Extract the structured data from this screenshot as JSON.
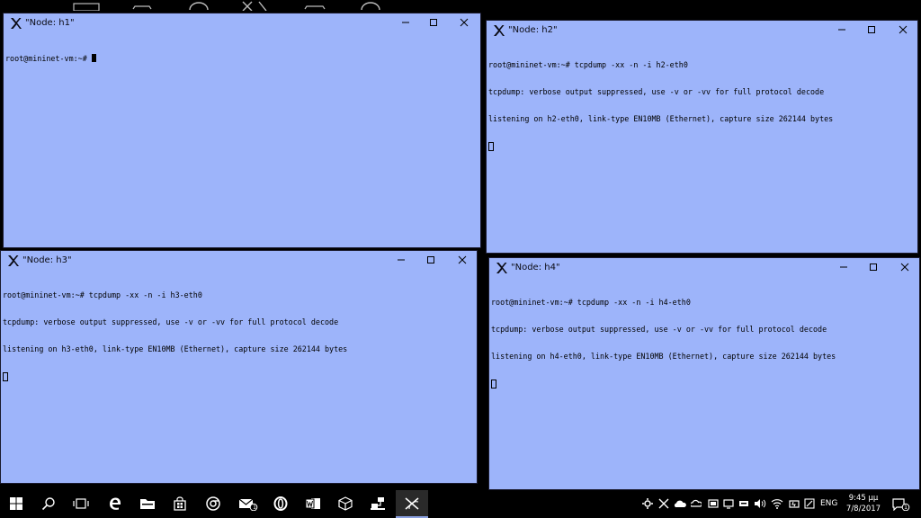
{
  "colors": {
    "window_bg": "#9db4fa",
    "desktop": "#000000",
    "taskbar": "#000000"
  },
  "windows": [
    {
      "title": "\"Node: h1\"",
      "lines": [
        "root@mininet-vm:~# "
      ]
    },
    {
      "title": "\"Node: h2\"",
      "lines": [
        "root@mininet-vm:~# tcpdump -xx -n -i h2-eth0",
        "tcpdump: verbose output suppressed, use -v or -vv for full protocol decode",
        "listening on h2-eth0, link-type EN10MB (Ethernet), capture size 262144 bytes"
      ]
    },
    {
      "title": "\"Node: h3\"",
      "lines": [
        "root@mininet-vm:~# tcpdump -xx -n -i h3-eth0",
        "tcpdump: verbose output suppressed, use -v or -vv for full protocol decode",
        "listening on h3-eth0, link-type EN10MB (Ethernet), capture size 262144 bytes"
      ]
    },
    {
      "title": "\"Node: h4\"",
      "lines": [
        "root@mininet-vm:~# tcpdump -xx -n -i h4-eth0",
        "tcpdump: verbose output suppressed, use -v or -vv for full protocol decode",
        "listening on h4-eth0, link-type EN10MB (Ethernet), capture size 262144 bytes"
      ]
    }
  ],
  "taskbar": {
    "icons": [
      "windows-start-icon",
      "search-icon",
      "task-view-icon",
      "edge-icon",
      "file-explorer-icon",
      "store-icon",
      "chrome-icon",
      "mail-icon",
      "opera-icon",
      "word-icon",
      "virtualbox-icon",
      "network-app-icon",
      "xming-icon"
    ],
    "mail_badge": "1",
    "language": "ENG",
    "time": "9:45 μμ",
    "date": "7/8/2017",
    "notification_count": "1"
  }
}
